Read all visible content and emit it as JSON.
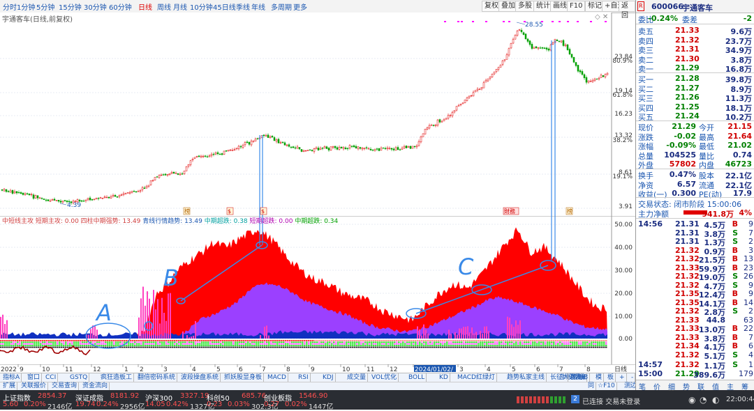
{
  "colors": {
    "up": "#d00000",
    "down": "#008000",
    "accent": "#1a56b0",
    "ind_red": "#ff0000",
    "ind_purple": "#9b40ff",
    "ind_blue": "#0030c0",
    "ind_magenta": "#ff40c0",
    "annotation": "#3a8ae8"
  },
  "period_tabs": [
    "分时",
    "1分钟",
    "5分钟",
    "15分钟",
    "30分钟",
    "60分钟",
    "日线",
    "周线",
    "月线",
    "10分钟",
    "45日线",
    "季线",
    "年线",
    "多周期",
    "更多"
  ],
  "active_period": "日线",
  "tool_buttons": [
    "复权",
    "叠加",
    "多股",
    "统计",
    "画线",
    "F10",
    "标记",
    "+自选",
    "返回"
  ],
  "main_chart": {
    "title": "宇通客车(日线,前复权)",
    "price_labels": [
      "23.84",
      "80.9%",
      "19.14",
      "61.8%",
      "16.23",
      "13.32",
      "38.2%",
      "8.61",
      "19.1%",
      "3.91"
    ],
    "high_label": "28.55",
    "low_label": "4.39",
    "markers": [
      "榜",
      "$",
      "$",
      "財務",
      "榜"
    ]
  },
  "indicator": {
    "title_items": [
      {
        "text": "中短线主攻 短期主攻: 0.00",
        "color": "#d04040"
      },
      {
        "text": "四柱中期强势: 13.49",
        "color": "#d04040"
      },
      {
        "text": "青线行情趋势: 13.49",
        "color": "#1a56b0"
      },
      {
        "text": "中期超跌: 0.38",
        "color": "#00a0a0"
      },
      {
        "text": "短期超跌: 0.00",
        "color": "#b000b0"
      },
      {
        "text": "中期超跌: 0.34",
        "color": "#00a000"
      }
    ],
    "y_labels": [
      "50.00",
      "40.00",
      "30.00",
      "20.00",
      "10.00",
      "0.00"
    ],
    "annotations": [
      "A",
      "B",
      "C"
    ]
  },
  "date_axis": [
    "2022",
    "9",
    "10",
    "11",
    "12",
    "1",
    "2",
    "3",
    "4",
    "5",
    "6",
    "7",
    "8",
    "9",
    "10",
    "11",
    "12",
    "2024/01/02/",
    "3",
    "4",
    "5",
    "6",
    "7",
    "8"
  ],
  "date_axis_suffix": "日线",
  "tabs_row1": [
    "指标A",
    "窗口",
    "CCI",
    "GSTQ",
    "疯狂造板工",
    "翻倍密码系统",
    "波段操盘系统",
    "抓妖股显身板",
    "MACD",
    "RSI",
    "KDJ",
    "成交量",
    "VOL优化",
    "BOLL",
    "KD",
    "MACD红绿灯",
    "趋势私家主线",
    "长征大潜发射",
    "牛股观察",
    "..."
  ],
  "tabs_row2": [
    "扩展",
    "关联报价",
    "交易查询",
    "资金流向"
  ],
  "tabs_row1_right": [
    "指标B",
    "模",
    "板",
    "+",
    "-"
  ],
  "tabs_row2_right": [
    "同",
    "☆F10",
    "测边控"
  ],
  "quote": {
    "code": "600066",
    "name": "宇通客车",
    "ratio_label": "委比",
    "ratio_value": "-0.24%",
    "diff_label": "委差",
    "diff_value": "-2",
    "asks": [
      {
        "label": "卖五",
        "price": "21.33",
        "vol": "9.6万"
      },
      {
        "label": "卖四",
        "price": "21.32",
        "vol": "23.7万"
      },
      {
        "label": "卖三",
        "price": "21.31",
        "vol": "34.9万"
      },
      {
        "label": "卖二",
        "price": "21.30",
        "vol": "3.8万"
      },
      {
        "label": "卖一",
        "price": "21.29",
        "vol": "16.8万"
      }
    ],
    "bids": [
      {
        "label": "买一",
        "price": "21.28",
        "vol": "39.8万"
      },
      {
        "label": "买二",
        "price": "21.27",
        "vol": "8.9万"
      },
      {
        "label": "买三",
        "price": "21.26",
        "vol": "11.3万"
      },
      {
        "label": "买四",
        "price": "21.25",
        "vol": "18.1万"
      },
      {
        "label": "买五",
        "price": "21.24",
        "vol": "10.2万"
      }
    ],
    "stats": [
      {
        "l1": "现价",
        "v1": "21.29",
        "l2": "今开",
        "v2": "21.15",
        "c1": "green",
        "c2": "red"
      },
      {
        "l1": "涨跌",
        "v1": "-0.02",
        "l2": "最高",
        "v2": "21.64",
        "c1": "green",
        "c2": "red"
      },
      {
        "l1": "涨幅",
        "v1": "-0.09%",
        "l2": "最低",
        "v2": "21.02",
        "c1": "green",
        "c2": "green"
      },
      {
        "l1": "总量",
        "v1": "104525",
        "l2": "量比",
        "v2": "0.74",
        "c1": "navy",
        "c2": "navy"
      },
      {
        "l1": "外盘",
        "v1": "57802",
        "l2": "内盘",
        "v2": "46723",
        "c1": "red",
        "c2": "green"
      }
    ],
    "stats2": [
      {
        "l1": "换手",
        "v1": "0.47%",
        "l2": "股本",
        "v2": "22.1亿"
      },
      {
        "l1": "净资",
        "v1": "6.57",
        "l2": "流通",
        "v2": "22.1亿"
      },
      {
        "l1": "收益(一)",
        "v1": "0.300",
        "l2": "PE(动)",
        "v2": "17.9"
      }
    ],
    "trade_status": "交易状态: 闭市阶段 15:00:06",
    "net_flow_label": "主力净额",
    "net_flow_value": "941.8万",
    "net_flow_pct": "4%",
    "ticks": [
      {
        "t": "14:56",
        "p": "21.31",
        "v": "4.5万",
        "s": "B",
        "n": "9"
      },
      {
        "t": "",
        "p": "21.31",
        "v": "3.8万",
        "s": "S",
        "n": "7"
      },
      {
        "t": "",
        "p": "21.31",
        "v": "1.3万",
        "s": "S",
        "n": "2"
      },
      {
        "t": "",
        "p": "21.32",
        "v": "0.9万",
        "s": "B",
        "n": "3"
      },
      {
        "t": "",
        "p": "21.32",
        "v": "21.5万",
        "s": "B",
        "n": "13"
      },
      {
        "t": "",
        "p": "21.33",
        "v": "59.9万",
        "s": "B",
        "n": "23"
      },
      {
        "t": "",
        "p": "21.32",
        "v": "19.0万",
        "s": "S",
        "n": "26"
      },
      {
        "t": "",
        "p": "21.32",
        "v": "4.7万",
        "s": "S",
        "n": "9"
      },
      {
        "t": "",
        "p": "21.35",
        "v": "12.4万",
        "s": "B",
        "n": "9"
      },
      {
        "t": "",
        "p": "21.35",
        "v": "14.1万",
        "s": "B",
        "n": "14"
      },
      {
        "t": "",
        "p": "21.32",
        "v": "2.8万",
        "s": "S",
        "n": "2"
      },
      {
        "t": "",
        "p": "21.33",
        "v": "44.8",
        "s": "",
        "n": "63"
      },
      {
        "t": "",
        "p": "21.33",
        "v": "13.0万",
        "s": "B",
        "n": "22"
      },
      {
        "t": "",
        "p": "21.33",
        "v": "3.8万",
        "s": "B",
        "n": "7"
      },
      {
        "t": "",
        "p": "21.34",
        "v": "4.1万",
        "s": "B",
        "n": "6"
      },
      {
        "t": "",
        "p": "21.32",
        "v": "5.1万",
        "s": "S",
        "n": "4"
      },
      {
        "t": "14:57",
        "p": "21.32",
        "v": "1.1万",
        "s": "S",
        "n": "1"
      },
      {
        "t": "15:00",
        "p": "21.29",
        "v": "389.6万",
        "s": "",
        "n": "179"
      }
    ],
    "bottom_icons": [
      "笔",
      "价",
      "细",
      "势",
      "联",
      "值",
      "主",
      "筹"
    ]
  },
  "statusbar": {
    "items": [
      {
        "name": "上证指数",
        "val": "2854.37",
        "chg": "5.60",
        "pct": "0.20%",
        "amt": "2146亿"
      },
      {
        "name": "深证成指",
        "val": "8181.92",
        "chg": "19.74",
        "pct": "0.24%",
        "amt": "2956亿"
      },
      {
        "name": "沪深300",
        "val": "3327.19",
        "chg": "14.05",
        "pct": "0.42%",
        "amt": "1327亿"
      },
      {
        "name": "科创50",
        "val": "685.76",
        "chg": "0.23",
        "pct": "0.03%",
        "amt": "302.3亿"
      },
      {
        "name": "创业板指",
        "val": "1546.90",
        "chg": "0.27",
        "pct": "0.02%",
        "amt": "1447亿"
      }
    ],
    "connection": "已连接 交易未登录",
    "connection_num": "2",
    "clock": "22:00:44"
  }
}
